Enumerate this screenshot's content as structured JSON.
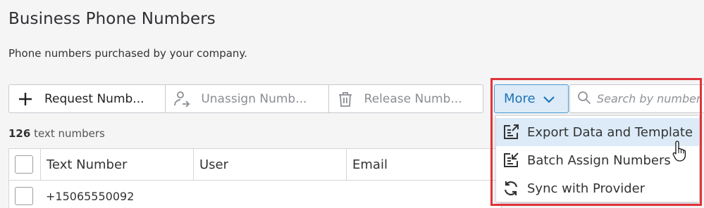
{
  "page": {
    "title": "Business Phone Numbers",
    "subtitle": "Phone numbers purchased by your company."
  },
  "toolbar": {
    "request_label": "Request Numb...",
    "unassign_label": "Unassign Numb...",
    "release_label": "Release Numb...",
    "more_label": "More",
    "search_placeholder": "Search by number"
  },
  "summary": {
    "count": "126",
    "count_suffix": "text numbers"
  },
  "table": {
    "columns": [
      "Text Number",
      "User",
      "Email"
    ],
    "rows": [
      {
        "text_number": "+15065550092",
        "user": "",
        "email": ""
      }
    ]
  },
  "more_menu": {
    "items": [
      {
        "label": "Export Data and Template",
        "icon": "export-icon",
        "active": true
      },
      {
        "label": "Batch Assign Numbers",
        "icon": "batch-assign-icon",
        "active": false
      },
      {
        "label": "Sync with Provider",
        "icon": "sync-icon",
        "active": false
      }
    ]
  },
  "colors": {
    "accent": "#1f74b9",
    "accent_bg": "#dcebf7",
    "highlight_border": "#e0333a",
    "disabled_text": "#8a8d93"
  }
}
